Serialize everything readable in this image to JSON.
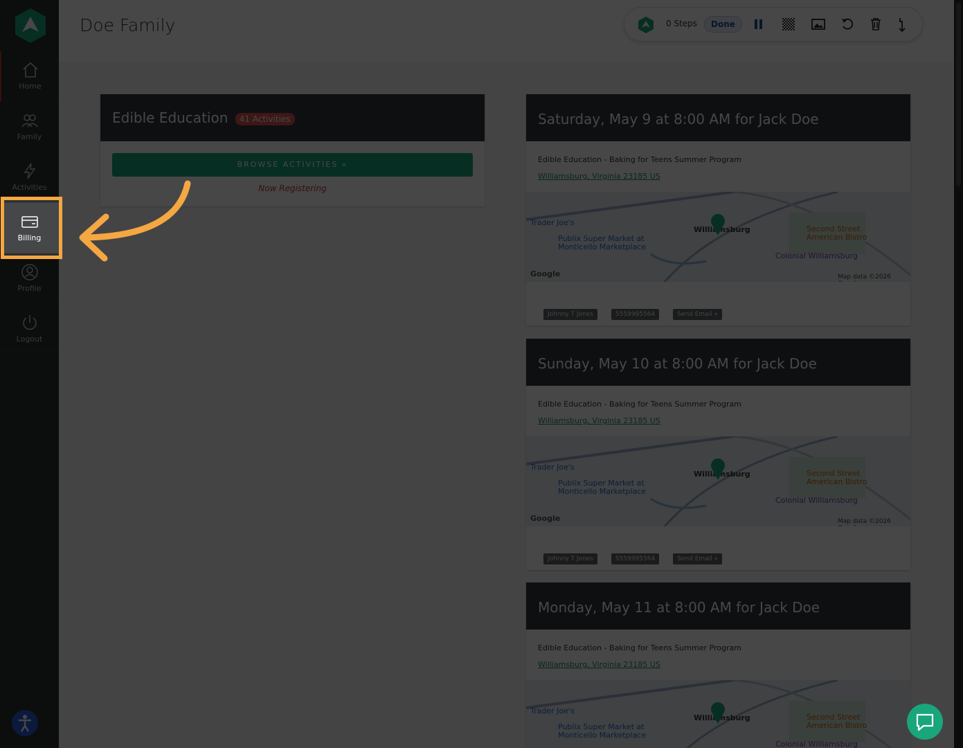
{
  "header": {
    "title": "Doe Family"
  },
  "sidebar": {
    "items": [
      {
        "label": "Home",
        "icon": "home-icon"
      },
      {
        "label": "Family",
        "icon": "family-icon"
      },
      {
        "label": "Activities",
        "icon": "bolt-icon"
      },
      {
        "label": "Billing",
        "icon": "credit-card-icon"
      },
      {
        "label": "Profile",
        "icon": "user-icon"
      },
      {
        "label": "Logout",
        "icon": "power-icon"
      }
    ]
  },
  "toolbar": {
    "steps": "0 Steps",
    "done": "Done"
  },
  "provider": {
    "name": "Edible Education",
    "badge": "41 Activities",
    "browse": "BROWSE ACTIVITIES »",
    "status": "Now Registering"
  },
  "events": [
    {
      "title": "Saturday, May 9 at 8:00 AM for Jack Doe",
      "program": "Edible Education - Baking for Teens Summer Program",
      "address": "Williamsburg, Virginia 23185 US",
      "contact": "Johnny T Jones",
      "phone": "5559995564",
      "email": "Send Email »"
    },
    {
      "title": "Sunday, May 10 at 8:00 AM for Jack Doe",
      "program": "Edible Education - Baking for Teens Summer Program",
      "address": "Williamsburg, Virginia 23185 US",
      "contact": "Johnny T Jones",
      "phone": "5559995564",
      "email": "Send Email »"
    },
    {
      "title": "Monday, May 11 at 8:00 AM for Jack Doe",
      "program": "Edible Education - Baking for Teens Summer Program",
      "address": "Williamsburg, Virginia 23185 US"
    }
  ],
  "map": {
    "traderjoes": "Trader Joe's",
    "publix": "Publix Super Market at Monticello Marketplace",
    "williamsburg": "Williamsburg",
    "secondstreet": "Second Street American Bistro",
    "colonial": "Colonial Williamsburg",
    "google": "Google",
    "mapdata": "Map data ©2026 Google"
  },
  "colors": {
    "accent": "#1aa67c",
    "highlight": "#f4a742",
    "danger": "#d9534f"
  }
}
